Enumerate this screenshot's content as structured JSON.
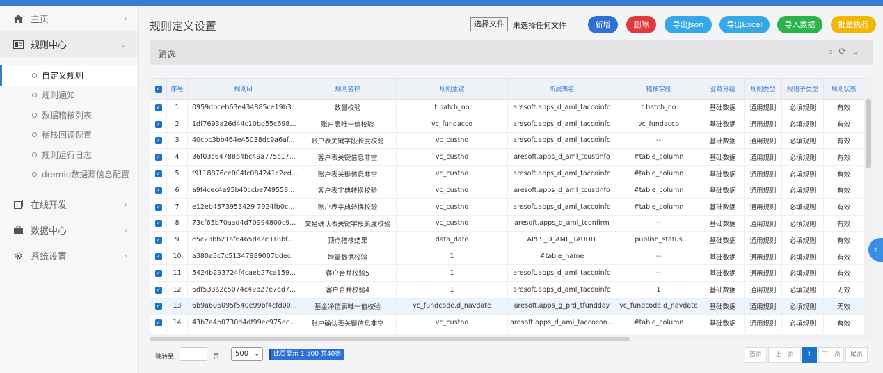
{
  "sidebar": {
    "items": [
      {
        "label": "主页",
        "icon": "home-icon"
      },
      {
        "label": "规则中心",
        "icon": "rules-icon"
      },
      {
        "label": "在线开发",
        "icon": "dev-icon"
      },
      {
        "label": "数据中心",
        "icon": "data-icon"
      },
      {
        "label": "系统设置",
        "icon": "gear-icon"
      }
    ],
    "sub_items": [
      "自定义规则",
      "规则通知",
      "数据稽核列表",
      "稽核回调配置",
      "规则运行日志",
      "dremio数据源信息配置"
    ]
  },
  "page": {
    "title": "规则定义设置",
    "file_button": "选择文件",
    "file_status": "未选择任何文件"
  },
  "toolbar": {
    "buttons": [
      {
        "label": "新增",
        "color": "#2f6fd6"
      },
      {
        "label": "删除",
        "color": "#e0393e"
      },
      {
        "label": "导出Json",
        "color": "#35a8e8"
      },
      {
        "label": "导出Excel",
        "color": "#35a8e8"
      },
      {
        "label": "导入数据",
        "color": "#2bb24c"
      },
      {
        "label": "批量执行",
        "color": "#f2b705"
      }
    ]
  },
  "filter": {
    "label": "筛选"
  },
  "table": {
    "headers": [
      "序号",
      "规则Id",
      "规则名称",
      "规则主键",
      "所属表名",
      "稽核字段",
      "业务分组",
      "规则类型",
      "规则子类型",
      "规则状态"
    ],
    "rows": [
      [
        "1",
        "0959dbceb63e434885ce19b3...",
        "数量校验",
        "t.batch_no",
        "aresoft.apps_d_aml_taccoinfo",
        "t.batch_no",
        "基础数据",
        "通用规则",
        "必填规则",
        "有效"
      ],
      [
        "2",
        "1df7693a26d44c10bd55c698...",
        "账户表唯一值校验",
        "vc_fundacco",
        "aresoft.apps_d_aml_taccoinfo",
        "vc_fundacco",
        "基础数据",
        "通用规则",
        "必填规则",
        "有效"
      ],
      [
        "3",
        "40cbc3bb464e45038dc9a6af...",
        "账户表关键字段长度校验",
        "vc_custno",
        "aresoft.apps_d_aml_taccoinfo",
        "--",
        "基础数据",
        "通用规则",
        "必填规则",
        "有效"
      ],
      [
        "4",
        "36f03c64788b4bc49a775c17...",
        "客户表关键信息非空",
        "vc_custno",
        "aresoft.apps_d_aml_tcustinfo",
        "#table_column",
        "基础数据",
        "通用规则",
        "必填规则",
        "有效"
      ],
      [
        "5",
        "f9118876ce004fc084241c2ed...",
        "账户表关键信息非空",
        "vc_custno",
        "aresoft.apps_d_aml_taccoinfo",
        "#table_column",
        "基础数据",
        "通用规则",
        "必填规则",
        "有效"
      ],
      [
        "6",
        "a9f4cec4a95b40ccbe749558...",
        "客户表字典转换校验",
        "vc_custno",
        "aresoft.apps_d_aml_tcustinfo",
        "#table_column",
        "基础数据",
        "通用规则",
        "必填规则",
        "有效"
      ],
      [
        "7",
        "e12eb4573953429 7924fb0cd...",
        "账户表字典转换校验",
        "vc_custno",
        "aresoft.apps_d_aml_taccoinfo",
        "#table_column",
        "基础数据",
        "通用规则",
        "必填规则",
        "有效"
      ],
      [
        "8",
        "73cf65b70aad4d70994800c9...",
        "交易确认表关键字段长度校验",
        "vc_custno",
        "aresoft.apps_d_aml_tconfirm",
        "--",
        "基础数据",
        "通用规则",
        "必填规则",
        "有效"
      ],
      [
        "9",
        "e5c28bb21af6465da2c318bf...",
        "顶点稽核结果",
        "data_date",
        "APPS_D_AML_TAUDIT",
        "publish_status",
        "基础数据",
        "通用规则",
        "必填规则",
        "有效"
      ],
      [
        "10",
        "a380a5c7c51347889007bdec...",
        "增量数据校验",
        "1",
        "#table_name",
        "--",
        "基础数据",
        "通用规则",
        "必填规则",
        "有效"
      ],
      [
        "11",
        "5424b293724f4caeb27ca159...",
        "客户合并校验5",
        "1",
        "aresoft.apps_d_aml_taccoinfo",
        "--",
        "基础数据",
        "通用规则",
        "必填规则",
        "有效"
      ],
      [
        "12",
        "6df533a2c5074c49b27e7ed7...",
        "客户合并校验4",
        "1",
        "aresoft.apps_d_aml_taccoinfo",
        "1",
        "基础数据",
        "通用规则",
        "必填规则",
        "无效"
      ],
      [
        "13",
        "6b9a606095f540e99bf4cfd00...",
        "基金净值表唯一值校验",
        "vc_fundcode,d_navdate",
        "aresoft.apps_g_prd_tfundday",
        "vc_fundcode,d_navdate",
        "基础数据",
        "通用规则",
        "必填规则",
        "无效"
      ],
      [
        "14",
        "43b7a4b0730d4df99ec975ec...",
        "账户确认表关键信息非空",
        "vc_custno",
        "aresoft.apps_d_aml_taccocon...",
        "#table_column",
        "基础数据",
        "通用规则",
        "必填规则",
        "有效"
      ]
    ],
    "highlight_row": 13
  },
  "pager": {
    "jump_label": "跳转至",
    "page_label": "页",
    "page_size": "500",
    "info": "此页显示 1-500 共40条",
    "first": "首页",
    "prev": "上一页",
    "current": "1",
    "next": "下一页",
    "last": "尾页"
  }
}
